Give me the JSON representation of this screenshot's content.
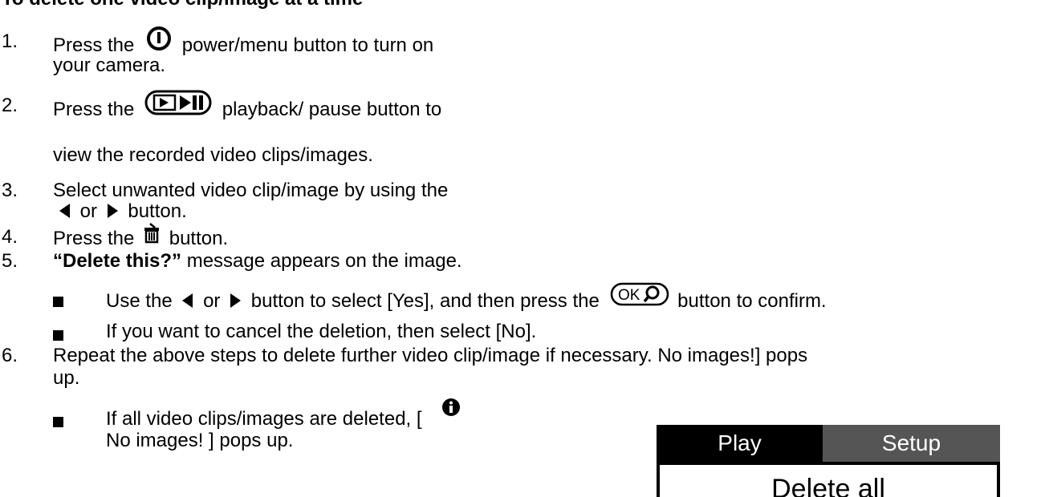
{
  "heading": "To delete one video clip/image at a time",
  "steps": [
    {
      "num": "1.",
      "pre": "Press the",
      "post": "power/menu button to turn on",
      "line2": "your camera."
    },
    {
      "num": "2.",
      "pre": "Press the",
      "post": "playback/ pause button to",
      "line2": "view the recorded video clips/images."
    },
    {
      "num": "3.",
      "line1": "Select unwanted video clip/image by using the",
      "or": "or",
      "button": "button."
    },
    {
      "num": "4.",
      "pre": "Press the",
      "post": "button."
    },
    {
      "num": "5.",
      "bold": "“Delete this?”",
      "post": " message appears on the image."
    },
    {
      "num": "6.",
      "line1": "Repeat the above steps to delete further video clip/image if necessary. No images!] pops",
      "line2": "up."
    }
  ],
  "bullets5": [
    {
      "pre": "Use the",
      "or": "or",
      "mid": "button to select [Yes], and then press the",
      "post": "button to confirm."
    },
    {
      "text": "If you want to cancel the deletion, then select [No]."
    }
  ],
  "bullet6": {
    "line1": "If all video clips/images are deleted, [",
    "line2": "No images! ] pops up."
  },
  "menu": {
    "tab_play": "Play",
    "tab_setup": "Setup",
    "item": "Delete all"
  },
  "icons": {
    "power": "power-icon",
    "playback": "playback-pause-icon",
    "left": "left-arrow-icon",
    "right": "right-arrow-icon",
    "trash": "trash-icon",
    "ok": "ok-zoom-icon",
    "info": "info-icon"
  }
}
